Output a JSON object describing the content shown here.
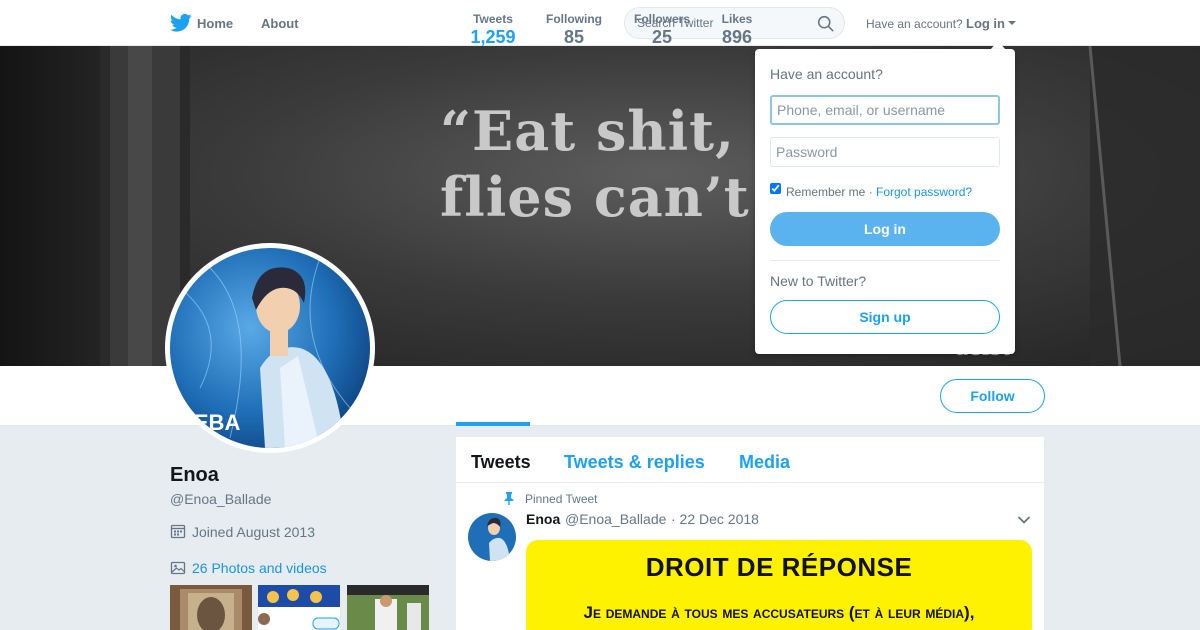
{
  "colors": {
    "accent": "#1da1f2",
    "link": "#1b95e0",
    "muted": "#657786",
    "background": "#e6ecf0",
    "media_bg": "#fff200"
  },
  "nav": {
    "logo_icon": "twitter-bird-icon",
    "home_label": "Home",
    "about_label": "About",
    "search_placeholder": "Search Twitter",
    "search_icon": "search-icon",
    "have_account": "Have an account?",
    "login_label": "Log in",
    "caret_icon": "caret-down-icon"
  },
  "banner": {
    "quote": "“Eat shit, mi\nflies can’t b",
    "signature": "aeist"
  },
  "stats": [
    {
      "label": "Tweets",
      "value": "1,259",
      "active": true
    },
    {
      "label": "Following",
      "value": "85",
      "active": false
    },
    {
      "label": "Followers",
      "value": "25",
      "active": false
    },
    {
      "label": "Likes",
      "value": "896",
      "active": false
    }
  ],
  "follow_label": "Follow",
  "profile": {
    "name": "Enoa",
    "handle": "@Enoa_Ballade",
    "joined": "Joined August 2013",
    "photos": "26 Photos and videos",
    "avatar_text": "AEBA"
  },
  "timeline": {
    "tabs": [
      {
        "label": "Tweets",
        "active": true
      },
      {
        "label": "Tweets & replies",
        "active": false
      },
      {
        "label": "Media",
        "active": false
      }
    ],
    "pinned_label": "Pinned Tweet",
    "tweet": {
      "name": "Enoa",
      "handle": "@Enoa_Ballade",
      "date": "· 22 Dec 2018",
      "media_title": "DROIT DE RÉPONSE",
      "media_line": "Je demande à tous mes accusateurs (et à leur média),"
    }
  },
  "login_dropdown": {
    "title": "Have an account?",
    "username_placeholder": "Phone, email, or username",
    "password_placeholder": "Password",
    "remember_label": "Remember me ·",
    "remember_checked": true,
    "forgot_label": "Forgot password?",
    "login_button": "Log in",
    "new_label": "New to Twitter?",
    "signup_button": "Sign up"
  }
}
